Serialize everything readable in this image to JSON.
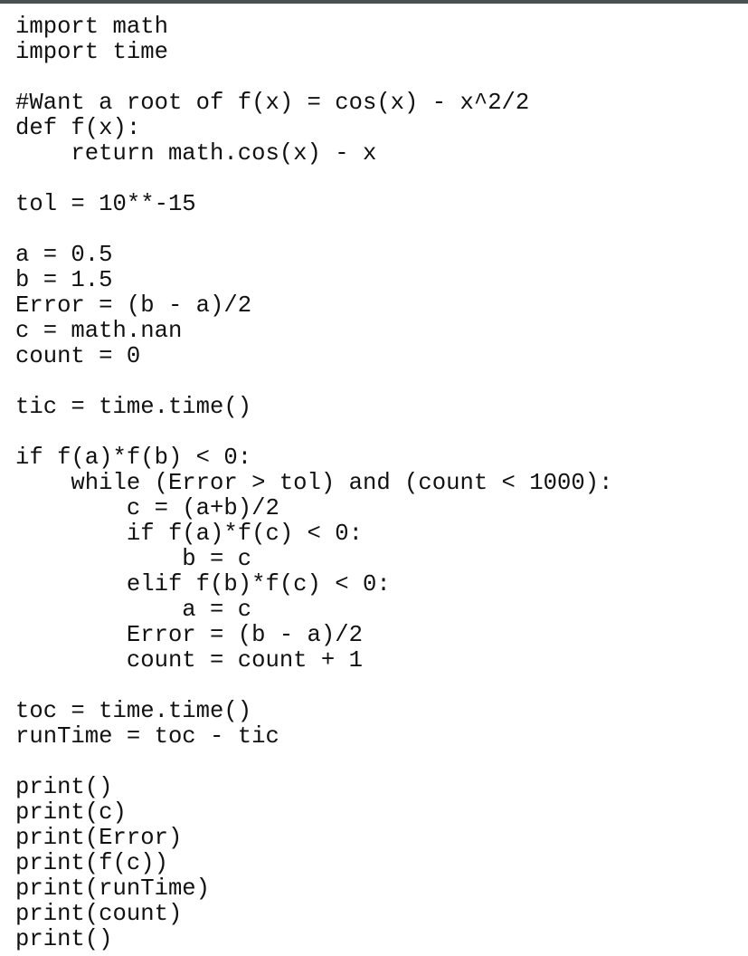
{
  "code": {
    "language": "python",
    "lines": [
      "import math",
      "import time",
      "",
      "#Want a root of f(x) = cos(x) - x^2/2",
      "def f(x):",
      "    return math.cos(x) - x",
      "",
      "tol = 10**-15",
      "",
      "a = 0.5",
      "b = 1.5",
      "Error = (b - a)/2",
      "c = math.nan",
      "count = 0",
      "",
      "tic = time.time()",
      "",
      "if f(a)*f(b) < 0:",
      "    while (Error > tol) and (count < 1000):",
      "        c = (a+b)/2",
      "        if f(a)*f(c) < 0:",
      "            b = c",
      "        elif f(b)*f(c) < 0:",
      "            a = c",
      "        Error = (b - a)/2",
      "        count = count + 1",
      "",
      "toc = time.time()",
      "runTime = toc - tic",
      "",
      "print()",
      "print(c)",
      "print(Error)",
      "print(f(c))",
      "print(runTime)",
      "print(count)",
      "print()"
    ]
  }
}
